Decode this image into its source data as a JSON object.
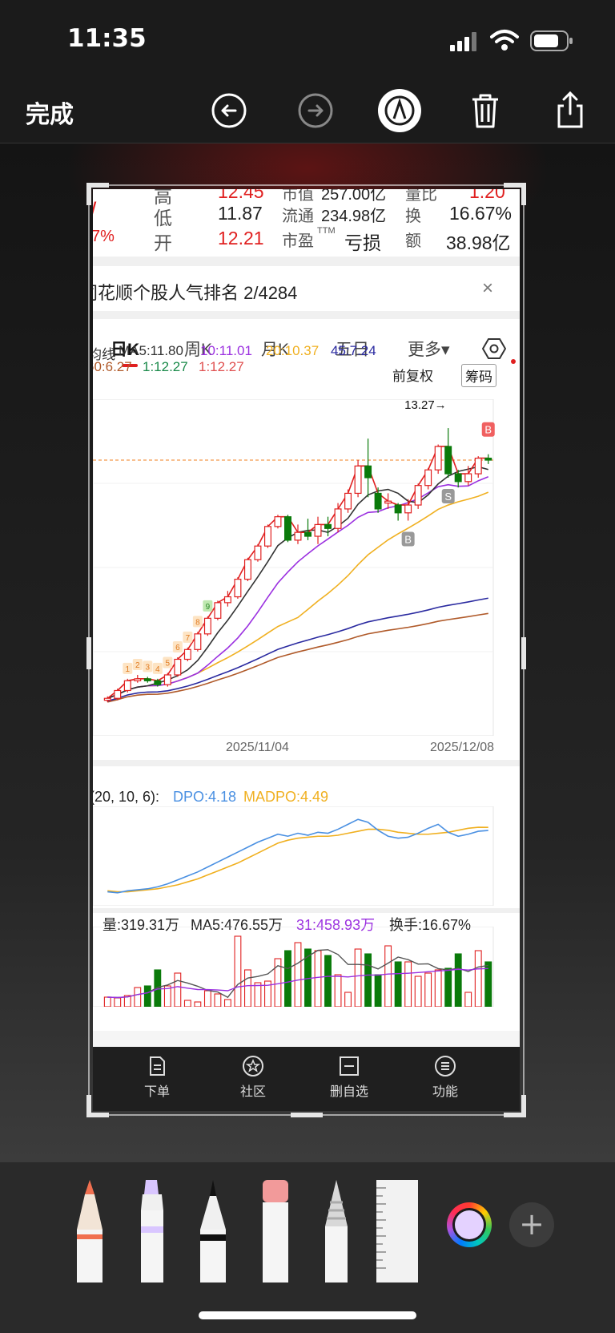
{
  "status": {
    "time": "11:35"
  },
  "toolbar": {
    "done": "完成"
  },
  "quote": {
    "row0": {
      "l1": "高",
      "v1": "12.45",
      "l2": "市值",
      "v2": "257.00亿",
      "l3": "量比",
      "v3": "1.20"
    },
    "row1": {
      "left": "/",
      "l1": "低",
      "v1": "11.87",
      "l2": "流通",
      "v2": "234.98亿",
      "l3": "换",
      "v3": "16.67%"
    },
    "row2": {
      "left": "7%",
      "l1": "开",
      "v1": "12.21",
      "l2": "市盈",
      "l2sup": "TTM",
      "v2": "亏损",
      "l3": "额",
      "v3": "38.98亿"
    }
  },
  "rank": {
    "text": "同花顺个股人气排名 2/4284",
    "close": "×"
  },
  "tabs": [
    "日K",
    "周K",
    "月K",
    "五日",
    "更多▾"
  ],
  "ma": {
    "prefix": "均线",
    "ma5": "MA5:11.80",
    "ma10": "10:11.01",
    "ma20": "20:10.37",
    "ma45": "45:7.24",
    "restore": "前复权",
    "chips": "筹码",
    "l2a": "60:6.27",
    "l2b": "1:12.27",
    "l2c": "1:12.27",
    "colors": {
      "ma5": "#333333",
      "ma10": "#9b30e0",
      "ma20": "#f0b020",
      "ma45": "#2a2aa0",
      "ma60": "#b05a2a",
      "up": "#e02020",
      "down": "#0a7a0a"
    }
  },
  "chart_data": {
    "type": "candlestick",
    "high_label": "13.27→",
    "signals": [
      "B",
      "S",
      "B"
    ],
    "count_labels": [
      "1",
      "2",
      "3",
      "4",
      "5",
      "6",
      "7",
      "8",
      "9"
    ],
    "x_ticks": [
      "2025/11/04",
      "2025/12/08"
    ],
    "candles": [
      {
        "o": 6.3,
        "c": 6.35,
        "h": 6.4,
        "l": 6.25
      },
      {
        "o": 6.35,
        "c": 6.55,
        "h": 6.6,
        "l": 6.3
      },
      {
        "o": 6.55,
        "c": 6.8,
        "h": 6.85,
        "l": 6.5
      },
      {
        "o": 6.8,
        "c": 6.85,
        "h": 6.95,
        "l": 6.75
      },
      {
        "o": 6.85,
        "c": 6.8,
        "h": 6.9,
        "l": 6.75
      },
      {
        "o": 6.8,
        "c": 6.7,
        "h": 6.85,
        "l": 6.65
      },
      {
        "o": 6.7,
        "c": 6.95,
        "h": 7.0,
        "l": 6.65
      },
      {
        "o": 6.95,
        "c": 7.35,
        "h": 7.4,
        "l": 6.9
      },
      {
        "o": 7.35,
        "c": 7.6,
        "h": 7.65,
        "l": 7.3
      },
      {
        "o": 7.6,
        "c": 8.0,
        "h": 8.05,
        "l": 7.55
      },
      {
        "o": 8.0,
        "c": 8.4,
        "h": 8.45,
        "l": 7.95
      },
      {
        "o": 8.4,
        "c": 8.8,
        "h": 8.85,
        "l": 8.35
      },
      {
        "o": 8.8,
        "c": 8.95,
        "h": 9.1,
        "l": 8.7
      },
      {
        "o": 8.95,
        "c": 9.4,
        "h": 9.45,
        "l": 8.9
      },
      {
        "o": 9.4,
        "c": 9.9,
        "h": 9.95,
        "l": 9.35
      },
      {
        "o": 9.9,
        "c": 10.25,
        "h": 10.3,
        "l": 9.85
      },
      {
        "o": 10.25,
        "c": 10.75,
        "h": 10.8,
        "l": 10.2
      },
      {
        "o": 10.75,
        "c": 11.0,
        "h": 11.05,
        "l": 10.7
      },
      {
        "o": 11.0,
        "c": 10.4,
        "h": 11.05,
        "l": 10.35
      },
      {
        "o": 10.4,
        "c": 10.6,
        "h": 10.8,
        "l": 10.3
      },
      {
        "o": 10.6,
        "c": 10.5,
        "h": 10.95,
        "l": 10.4
      },
      {
        "o": 10.5,
        "c": 10.8,
        "h": 11.0,
        "l": 10.3
      },
      {
        "o": 10.8,
        "c": 10.7,
        "h": 11.0,
        "l": 10.5
      },
      {
        "o": 10.7,
        "c": 11.2,
        "h": 11.35,
        "l": 10.6
      },
      {
        "o": 11.2,
        "c": 11.6,
        "h": 11.7,
        "l": 11.1
      },
      {
        "o": 11.6,
        "c": 12.3,
        "h": 12.45,
        "l": 11.5
      },
      {
        "o": 12.3,
        "c": 12.0,
        "h": 13.0,
        "l": 11.5
      },
      {
        "o": 11.6,
        "c": 11.2,
        "h": 11.75,
        "l": 11.1
      },
      {
        "o": 11.35,
        "c": 11.4,
        "h": 11.6,
        "l": 11.2
      },
      {
        "o": 11.3,
        "c": 11.1,
        "h": 11.35,
        "l": 10.9
      },
      {
        "o": 11.1,
        "c": 11.3,
        "h": 11.45,
        "l": 10.9
      },
      {
        "o": 11.3,
        "c": 11.8,
        "h": 11.85,
        "l": 11.2
      },
      {
        "o": 11.8,
        "c": 12.2,
        "h": 12.25,
        "l": 11.7
      },
      {
        "o": 12.2,
        "c": 12.8,
        "h": 12.85,
        "l": 12.1
      },
      {
        "o": 12.8,
        "c": 12.1,
        "h": 13.27,
        "l": 12.0
      },
      {
        "o": 12.1,
        "c": 11.9,
        "h": 12.2,
        "l": 11.75
      },
      {
        "o": 11.9,
        "c": 12.1,
        "h": 12.3,
        "l": 11.8
      },
      {
        "o": 12.1,
        "c": 12.5,
        "h": 12.55,
        "l": 12.0
      },
      {
        "o": 12.5,
        "c": 12.45,
        "h": 12.6,
        "l": 12.35
      }
    ],
    "dpo": {
      "label": "(20, 10, 6):",
      "dpo_text": "DPO:4.18",
      "madpo_text": "MADPO:4.49",
      "dpo": [
        -2.0,
        -2.1,
        -1.9,
        -1.8,
        -1.7,
        -1.5,
        -1.2,
        -0.8,
        -0.4,
        0.0,
        0.5,
        1.0,
        1.5,
        2.0,
        2.5,
        3.0,
        3.4,
        3.8,
        3.6,
        3.9,
        3.7,
        4.0,
        3.9,
        4.3,
        4.8,
        5.3,
        5.0,
        4.2,
        3.6,
        3.4,
        3.5,
        3.9,
        4.4,
        4.8,
        4.0,
        3.6,
        3.8,
        4.1,
        4.18
      ],
      "madpo": [
        -1.9,
        -2.0,
        -2.0,
        -1.9,
        -1.8,
        -1.7,
        -1.5,
        -1.3,
        -1.0,
        -0.7,
        -0.3,
        0.1,
        0.5,
        0.9,
        1.4,
        1.9,
        2.4,
        2.9,
        3.2,
        3.4,
        3.5,
        3.6,
        3.6,
        3.7,
        3.9,
        4.1,
        4.3,
        4.3,
        4.2,
        4.0,
        3.9,
        3.8,
        3.8,
        3.9,
        4.0,
        4.2,
        4.4,
        4.5,
        4.49
      ]
    },
    "volume": {
      "vol_text": "量:319.31万",
      "ma5_text": "MA5:476.55万",
      "ma31_text": "31:458.93万",
      "turnover_text": "换手:16.67%",
      "vol": [
        60,
        55,
        70,
        120,
        130,
        230,
        130,
        210,
        40,
        30,
        100,
        80,
        45,
        440,
        230,
        150,
        160,
        300,
        350,
        400,
        360,
        350,
        320,
        200,
        90,
        360,
        330,
        200,
        380,
        280,
        280,
        190,
        210,
        230,
        240,
        330,
        90,
        350,
        280
      ]
    }
  },
  "nav": [
    "下单",
    "社区",
    "删自选",
    "功能"
  ]
}
